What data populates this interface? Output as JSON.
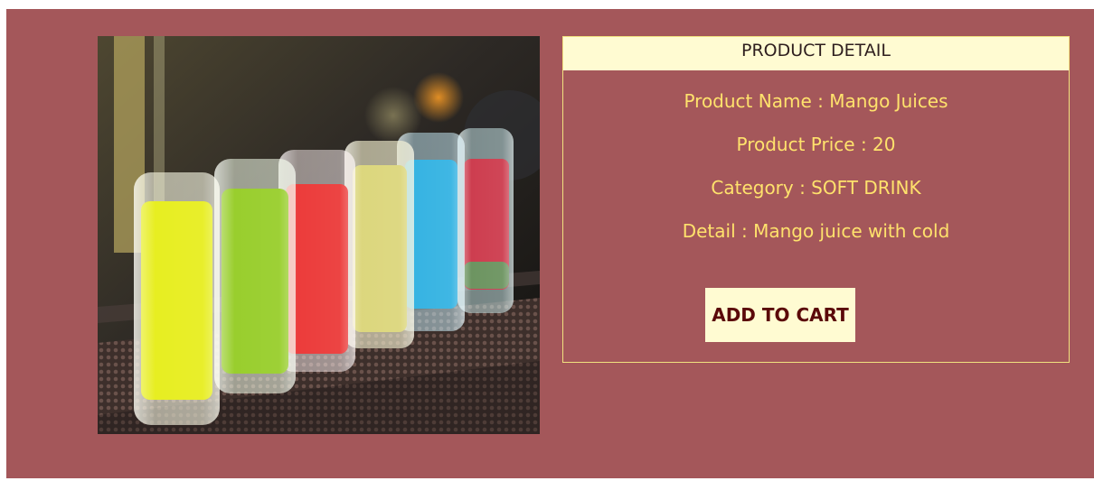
{
  "product_detail": {
    "header": "PRODUCT DETAIL",
    "name_line": "Product Name : Mango Juices",
    "price_line": "Product Price : 20",
    "category_line": "Category : SOFT DRINK",
    "detail_line": "Detail : Mango juice with cold",
    "add_to_cart_label": "ADD TO CART"
  },
  "colors": {
    "panel_background": "#a4575a",
    "header_background": "#fffbd2",
    "detail_text": "#ffe26c",
    "button_background": "#fffbd2",
    "button_text": "#5b0909"
  }
}
